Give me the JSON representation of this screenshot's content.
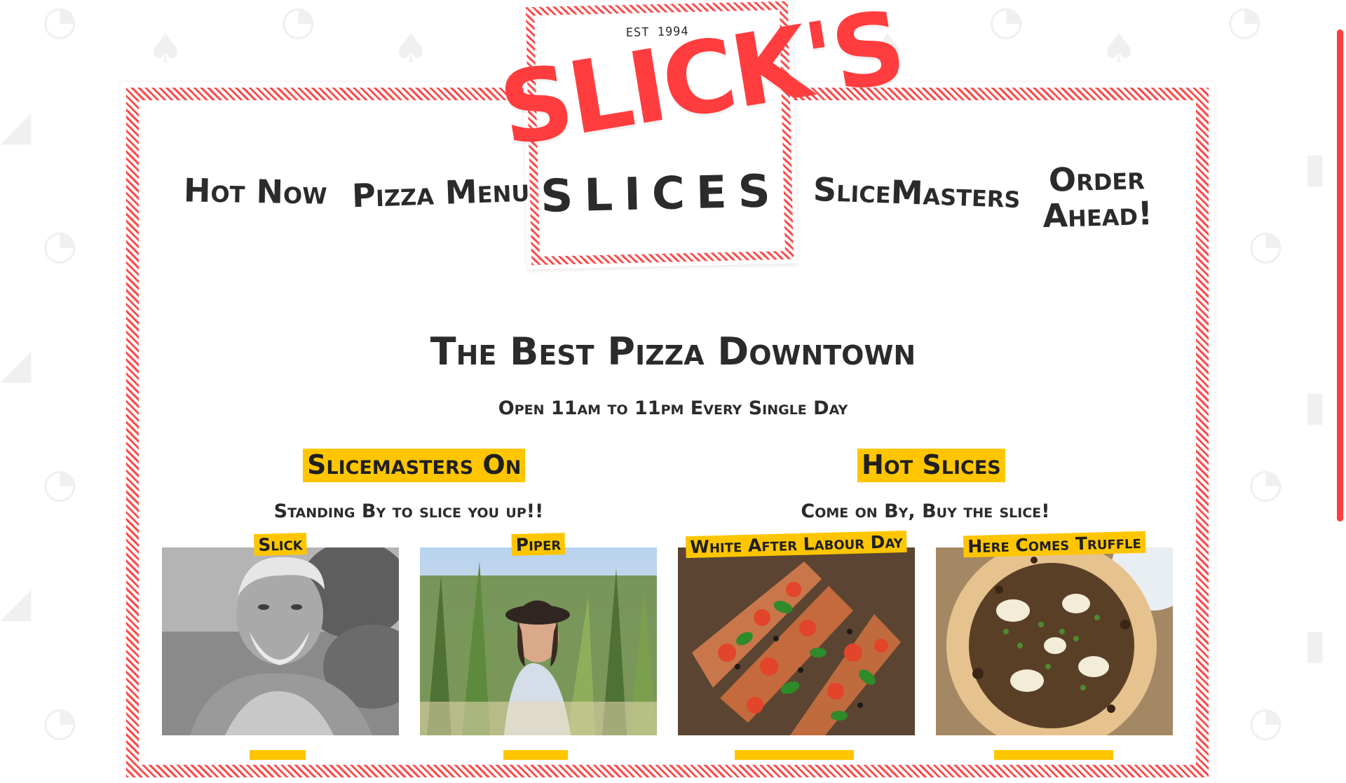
{
  "brand": {
    "est": "EST 1994",
    "name": "SLICK'S",
    "sub": "SLICES"
  },
  "nav": {
    "hot_now": "Hot Now",
    "pizza_menu": "Pizza Menu",
    "slicemasters": "SliceMasters",
    "order_ahead": "Order Ahead!"
  },
  "hero": {
    "title": "The Best Pizza Downtown",
    "subtitle": "Open 11am to 11pm Every Single Day"
  },
  "sections": {
    "slicemasters": {
      "heading": "Slicemasters On",
      "subtitle": "Standing By to slice you up!!"
    },
    "hot_slices": {
      "heading": "Hot Slices",
      "subtitle": "Come on By, Buy the slice!"
    }
  },
  "cards": [
    {
      "label": "Slick",
      "image": "portrait-older-man"
    },
    {
      "label": "Piper",
      "image": "portrait-woman-cornfield"
    },
    {
      "label": "White After Labour Day",
      "image": "pizza-slices"
    },
    {
      "label": "Here Comes Truffle",
      "image": "truffle-pizza"
    }
  ],
  "colors": {
    "accent_red": "#ff3d3f",
    "highlight_yellow": "#ffc600",
    "text_dark": "#2b2b2b"
  }
}
